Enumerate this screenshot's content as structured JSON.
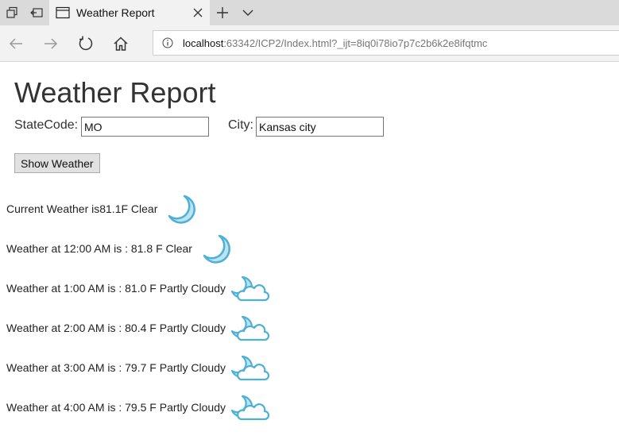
{
  "browser": {
    "tab_title": "Weather Report",
    "url_host": "localhost",
    "url_rest": ":63342/ICP2/Index.html?_ijt=8iq0i78io7p7c2b6k2e8ifqtmc"
  },
  "page": {
    "title": "Weather Report",
    "state_label": "StateCode:",
    "state_value": "MO",
    "city_label": "City:",
    "city_value": "Kansas city",
    "button_label": "Show Weather"
  },
  "weather": [
    {
      "text": "Current Weather is81.1F Clear",
      "icon": "moon-icon"
    },
    {
      "text": "Weather at 12:00 AM is : 81.8 F Clear",
      "icon": "moon-icon"
    },
    {
      "text": "Weather at 1:00 AM is : 81.0 F Partly Cloudy",
      "icon": "partly-cloudy-night-icon"
    },
    {
      "text": "Weather at 2:00 AM is : 80.4 F Partly Cloudy",
      "icon": "partly-cloudy-night-icon"
    },
    {
      "text": "Weather at 3:00 AM is : 79.7 F Partly Cloudy",
      "icon": "partly-cloudy-night-icon"
    },
    {
      "text": "Weather at 4:00 AM is : 79.5 F Partly Cloudy",
      "icon": "partly-cloudy-night-icon"
    }
  ],
  "colors": {
    "icon_fill": "#bde3ef",
    "icon_stroke": "#4db0d6"
  }
}
